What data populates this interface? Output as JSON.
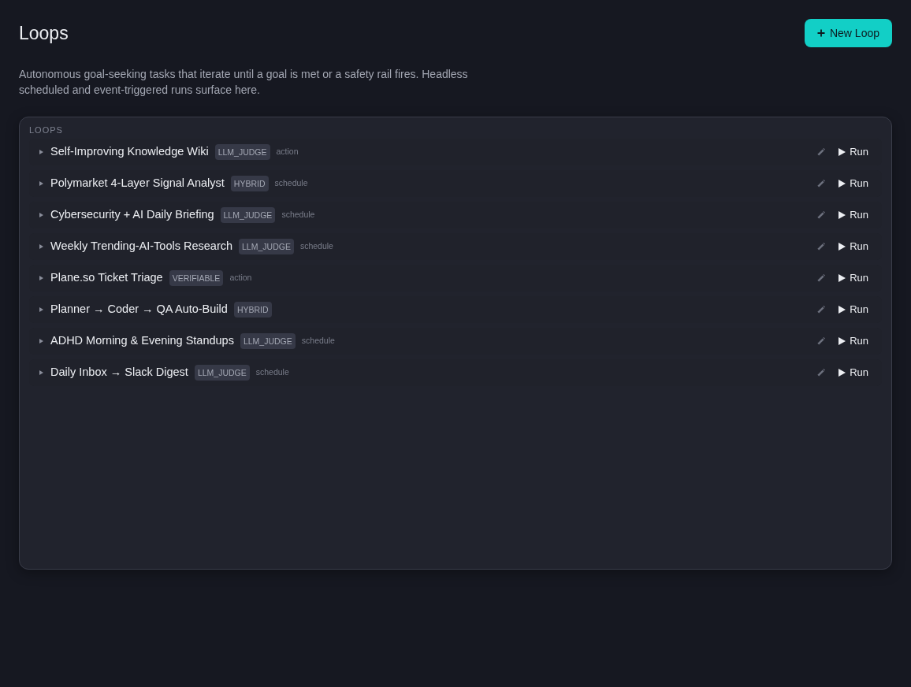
{
  "header": {
    "title": "Loops",
    "new_button": "New Loop",
    "description": "Autonomous goal-seeking tasks that iterate until a goal is met or a safety rail fires. Headless scheduled and event-triggered runs surface here."
  },
  "panel": {
    "label": "LOOPS",
    "loops": [
      {
        "name": "Self-Improving Knowledge Wiki",
        "mode": "LLM_JUDGE",
        "trigger": "action",
        "expanded": false,
        "run_label": "Run"
      },
      {
        "name": "Polymarket 4-Layer Signal Analyst",
        "mode": "HYBRID",
        "trigger": "schedule",
        "expanded": false,
        "run_label": "Run"
      },
      {
        "name": "Cybersecurity + AI Daily Briefing",
        "mode": "LLM_JUDGE",
        "trigger": "schedule",
        "expanded": false,
        "run_label": "Run"
      },
      {
        "name": "Weekly Trending-AI-Tools Research",
        "mode": "LLM_JUDGE",
        "trigger": "schedule",
        "expanded": false,
        "run_label": "Run"
      },
      {
        "name": "Plane.so Ticket Triage",
        "mode": "VERIFIABLE",
        "trigger": "action",
        "expanded": false,
        "run_label": "Run"
      },
      {
        "name": "Planner → Coder → QA Auto-Build",
        "mode": "HYBRID",
        "expanded": false,
        "run_label": "Run"
      },
      {
        "name": "ADHD Morning & Evening Standups",
        "mode": "LLM_JUDGE",
        "trigger": "schedule",
        "expanded": false,
        "run_label": "Run"
      },
      {
        "name": "Daily Inbox → Slack Digest",
        "mode": "LLM_JUDGE",
        "trigger": "schedule",
        "expanded": false,
        "run_label": "Run"
      }
    ]
  }
}
